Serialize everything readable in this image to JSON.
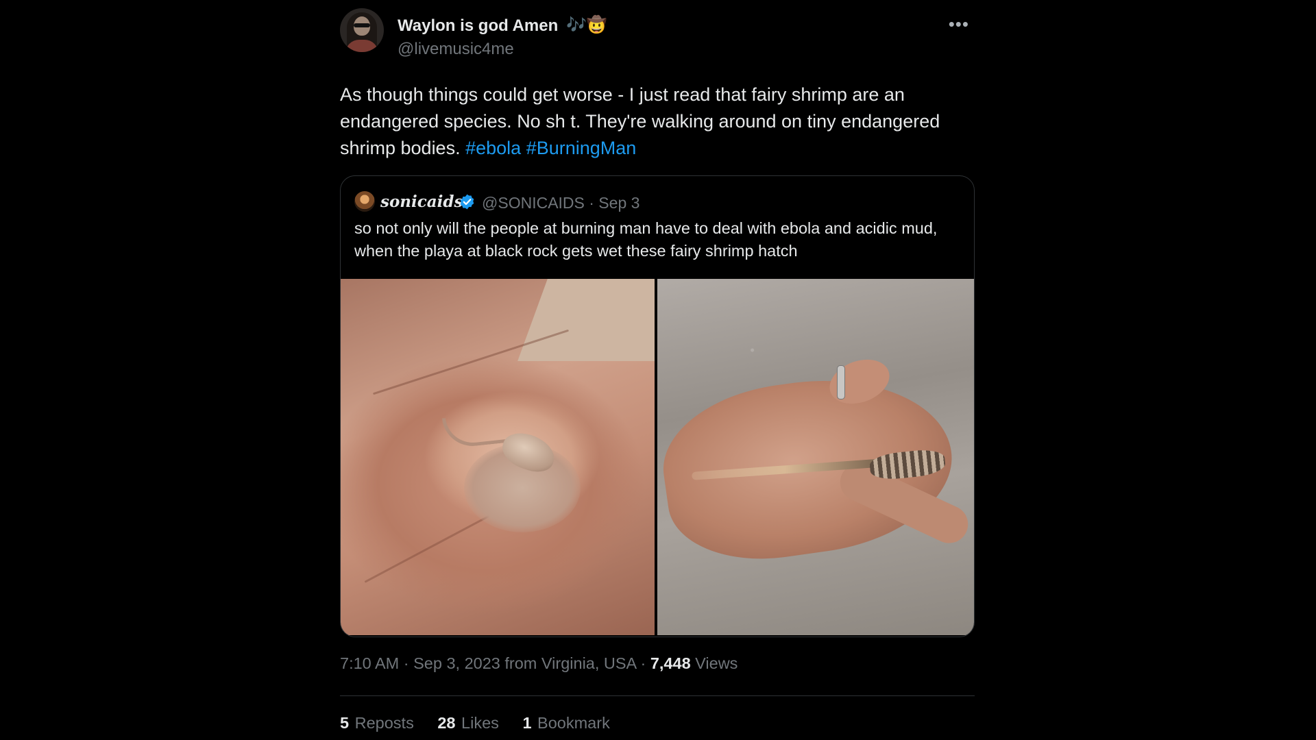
{
  "tweet": {
    "author": {
      "display_name": "Waylon is god Amen",
      "name_emojis": "🎶🤠",
      "handle": "@livemusic4me"
    },
    "more_icon": "more-icon",
    "text_main": "As though things could get worse - I just read that fairy shrimp are an endangered species. No sh t. They're walking around on tiny endangered shrimp bodies.",
    "hashtags": [
      "#ebola",
      "#BurningMan"
    ],
    "quote": {
      "display_name": "sonicaids",
      "verified": true,
      "handle_date": "@SONICAIDS · Sep 3",
      "text": "so not only will the people at burning man have to deal with ebola and acidic mud, when the playa at black rock gets wet these fairy shrimp hatch"
    },
    "meta": {
      "time_place": "7:10 AM · Sep 3, 2023 from Virginia, USA · ",
      "views_count": "7,448",
      "views_label": " Views"
    },
    "stats": [
      {
        "count": "5",
        "label": "Reposts"
      },
      {
        "count": "28",
        "label": "Likes"
      },
      {
        "count": "1",
        "label": "Bookmark"
      }
    ],
    "colors": {
      "background": "#000000",
      "text": "#e7e9ea",
      "muted": "#71767b",
      "link": "#1d9bf0",
      "border": "#2f3336"
    }
  }
}
